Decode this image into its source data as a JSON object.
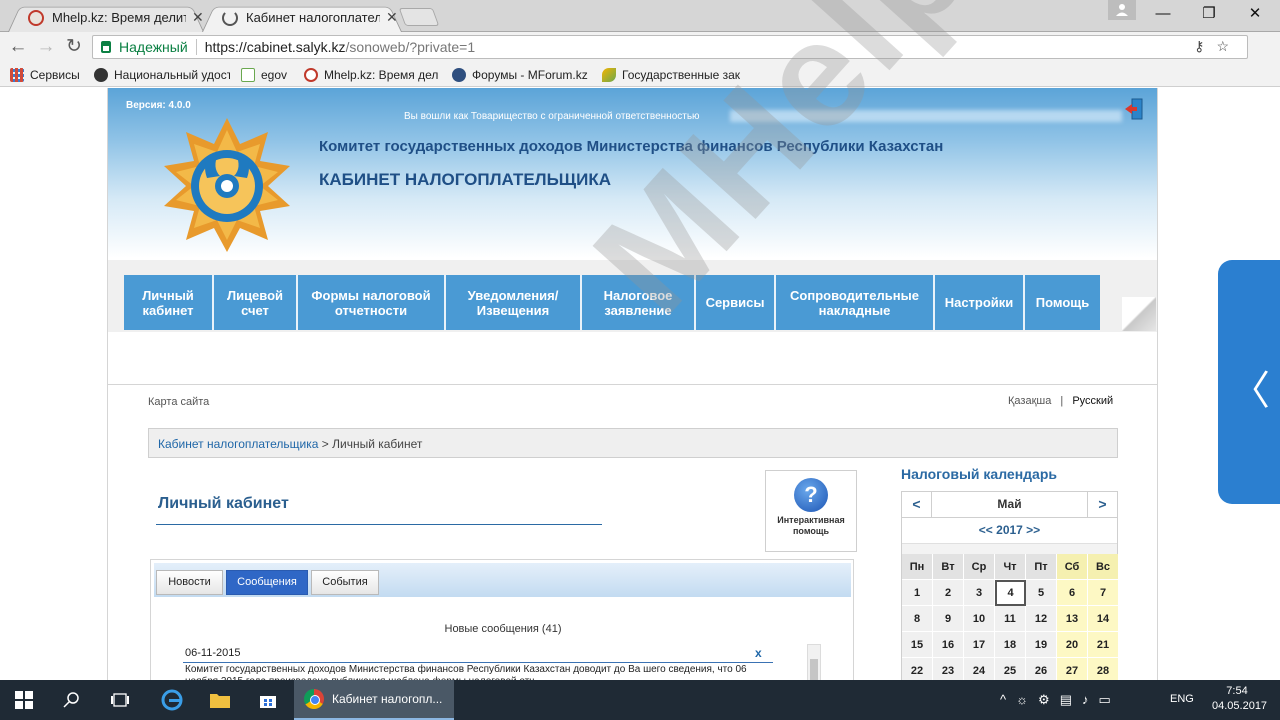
{
  "browser": {
    "tabs": [
      {
        "title": "Mhelp.kz: Время делить",
        "active": false
      },
      {
        "title": "Кабинет налогоплатель",
        "active": true
      }
    ],
    "window_controls": {
      "minimize": "—",
      "maximize": "❐",
      "close": "✕"
    },
    "secure_label": "Надежный",
    "url_host": "https://cabinet.salyk.kz",
    "url_path": "/sonoweb/?private=1",
    "bookmarks": [
      {
        "label": "Сервисы",
        "icon": "apps-grid-icon"
      },
      {
        "label": "Национальный удост",
        "icon": "emblem-icon"
      },
      {
        "label": "egov",
        "icon": "egov-icon"
      },
      {
        "label": "Mhelp.kz: Время дел",
        "icon": "mhelp-icon"
      },
      {
        "label": "Форумы - MForum.kz",
        "icon": "mforum-icon"
      },
      {
        "label": "Государственные зак",
        "icon": "leaf-icon"
      }
    ]
  },
  "site": {
    "version": "Версия: 4.0.0",
    "login_text": "Вы вошли как Товарищество с ограниченной ответственностью",
    "committee": "Комитет государственных доходов Министерства финансов Республики Казахстан",
    "cabinet_title": "КАБИНЕТ НАЛОГОПЛАТЕЛЬЩИКА",
    "nav": [
      {
        "line1": "Личный",
        "line2": "кабинет"
      },
      {
        "line1": "Лицевой",
        "line2": "счет"
      },
      {
        "line1": "Формы налоговой",
        "line2": "отчетности"
      },
      {
        "line1": "Уведомления/",
        "line2": "Извещения"
      },
      {
        "line1": "Налоговое",
        "line2": "заявление"
      },
      {
        "line1": "Сервисы",
        "line2": ""
      },
      {
        "line1": "Сопроводительные",
        "line2": "накладные"
      },
      {
        "line1": "Настройки",
        "line2": ""
      },
      {
        "line1": "Помощь",
        "line2": ""
      }
    ],
    "sitemap": "Карта сайта",
    "lang_kz": "Қазақша",
    "lang_sep": "|",
    "lang_ru": "Русский",
    "breadcrumb_link": "Кабинет налогоплательщика",
    "breadcrumb_sep": " > ",
    "breadcrumb_current": "Личный кабинет",
    "page_title": "Личный кабинет",
    "help_line1": "Интерактивная",
    "help_line2": "помощь",
    "help_symbol": "?",
    "panel_tabs": [
      "Новости",
      "Сообщения",
      "События"
    ],
    "active_panel_tab": "Сообщения",
    "new_messages": "Новые сообщения (41)",
    "message": {
      "date": "06-11-2015",
      "close": "x",
      "text": "Комитет государственных доходов Министерства финансов Республики Казахстан доводит до Ва шего сведения, что 06 ноября 2015 года произведена публикация шаблона формы налоговой отч"
    },
    "calendar": {
      "title": "Налоговый календарь",
      "prev": "<",
      "next": ">",
      "month": "Май",
      "year": "<< 2017 >>",
      "weekdays": [
        "Пн",
        "Вт",
        "Ср",
        "Чт",
        "Пт",
        "Сб",
        "Вс"
      ],
      "today": 4,
      "weeks": [
        [
          1,
          2,
          3,
          4,
          5,
          6,
          7
        ],
        [
          8,
          9,
          10,
          11,
          12,
          13,
          14
        ],
        [
          15,
          16,
          17,
          18,
          19,
          20,
          21
        ],
        [
          22,
          23,
          24,
          25,
          26,
          27,
          28
        ]
      ]
    }
  },
  "watermark": "MHelp.kz",
  "taskbar": {
    "app_label": "Кабинет налогопл...",
    "lang": "ENG",
    "time": "7:54",
    "date": "04.05.2017"
  },
  "colors": {
    "nav_blue": "#4a9ad4",
    "brand_dark_blue": "#1f4f86",
    "active_tab_blue": "#2f67c6",
    "weekend_yellow": "#fdf8c4",
    "taskbar": "#1f2a35"
  }
}
